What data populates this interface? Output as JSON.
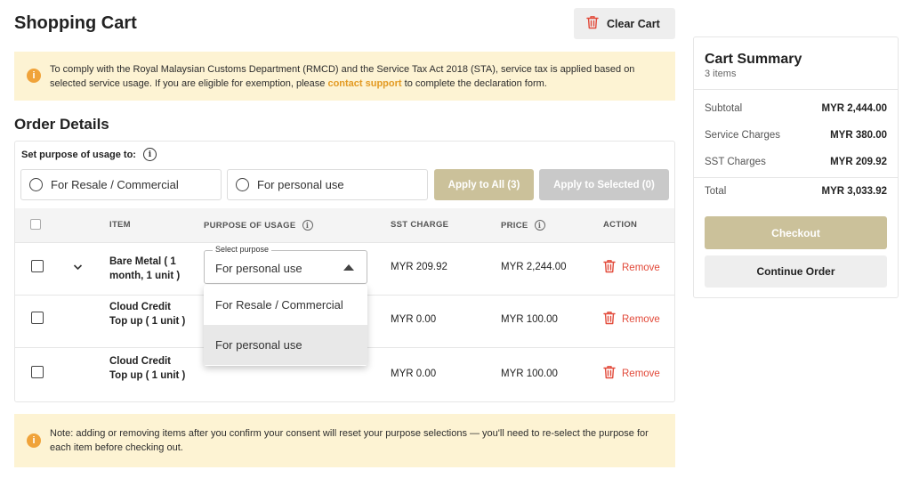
{
  "page_title": "Shopping Cart",
  "clear_cart_label": "Clear Cart",
  "notice_top": {
    "text_before": "To comply with the Royal Malaysian Customs Department (RMCD) and the Service Tax Act 2018 (STA), service tax is applied based on selected service usage. If you are eligible for exemption, please ",
    "link": "contact support",
    "text_after": " to complete the declaration form."
  },
  "order_details_title": "Order Details",
  "purpose_label": "Set purpose of usage to:",
  "radio_options": [
    "For Resale / Commercial",
    "For personal use"
  ],
  "apply_all_label": "Apply to All (3)",
  "apply_selected_label": "Apply to Selected (0)",
  "table_headers": {
    "item": "ITEM",
    "purpose": "PURPOSE OF USAGE",
    "sst": "SST CHARGE",
    "price": "PRICE",
    "action": "ACTION"
  },
  "rows": [
    {
      "item": "Bare Metal ( 1 month, 1 unit )",
      "sst": "MYR 209.92",
      "price": "MYR 2,244.00",
      "action": "Remove"
    },
    {
      "item": "Cloud Credit Top up ( 1 unit )",
      "sst": "MYR 0.00",
      "price": "MYR 100.00",
      "action": "Remove"
    },
    {
      "item": "Cloud Credit Top up ( 1 unit )",
      "sst": "MYR 0.00",
      "price": "MYR 100.00",
      "action": "Remove"
    }
  ],
  "select": {
    "legend": "Select purpose",
    "value": "For personal use",
    "options": [
      "For Resale / Commercial",
      "For personal use"
    ]
  },
  "notice_bottom": "Note: adding or removing items after you confirm your consent will reset your purpose selections — you'll need to re-select the purpose for each item before checking out.",
  "summary": {
    "title": "Cart Summary",
    "count": "3 items",
    "subtotal_label": "Subtotal",
    "subtotal": "MYR 2,444.00",
    "service_label": "Service Charges",
    "service": "MYR 380.00",
    "sst_label": "SST Charges",
    "sst": "MYR 209.92",
    "total_label": "Total",
    "total": "MYR 3,033.92",
    "checkout_label": "Checkout",
    "continue_label": "Continue Order"
  },
  "colors": {
    "accent_gold": "#cbc19a",
    "notice_bg": "#fdf3d3",
    "info_orange": "#f0a33a",
    "remove_red": "#e24a3a"
  }
}
